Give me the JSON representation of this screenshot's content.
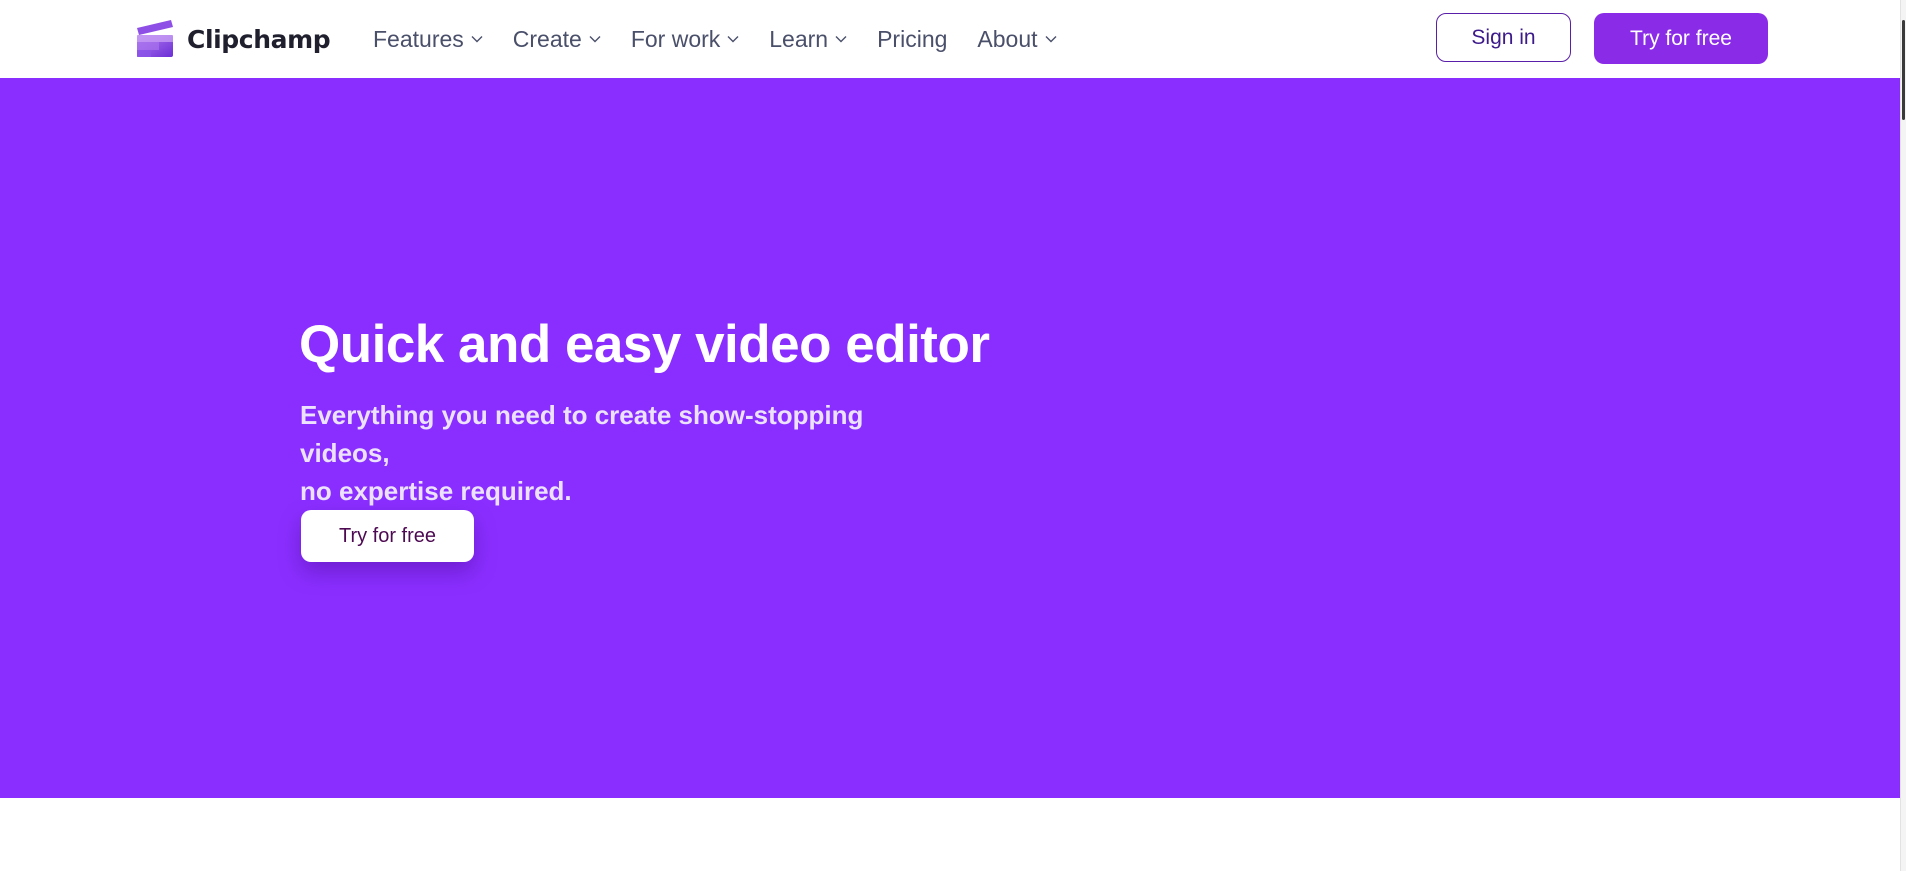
{
  "brand": {
    "name": "Clipchamp",
    "logo_icon": "clipchamp-logo-icon",
    "accent_color": "#8a2eff",
    "button_color": "#8a2be8"
  },
  "nav": {
    "items": [
      {
        "label": "Features",
        "has_dropdown": true
      },
      {
        "label": "Create",
        "has_dropdown": true
      },
      {
        "label": "For work",
        "has_dropdown": true
      },
      {
        "label": "Learn",
        "has_dropdown": true
      },
      {
        "label": "Pricing",
        "has_dropdown": false
      },
      {
        "label": "About",
        "has_dropdown": true
      }
    ],
    "dropdown_icon": "chevron-down-icon",
    "sign_in_label": "Sign in",
    "cta_label": "Try for free"
  },
  "hero": {
    "title": "Quick and easy video editor",
    "subtitle_line1": "Everything you need to create show-stopping videos,",
    "subtitle_line2": "no expertise required.",
    "cta_label": "Try for free"
  }
}
